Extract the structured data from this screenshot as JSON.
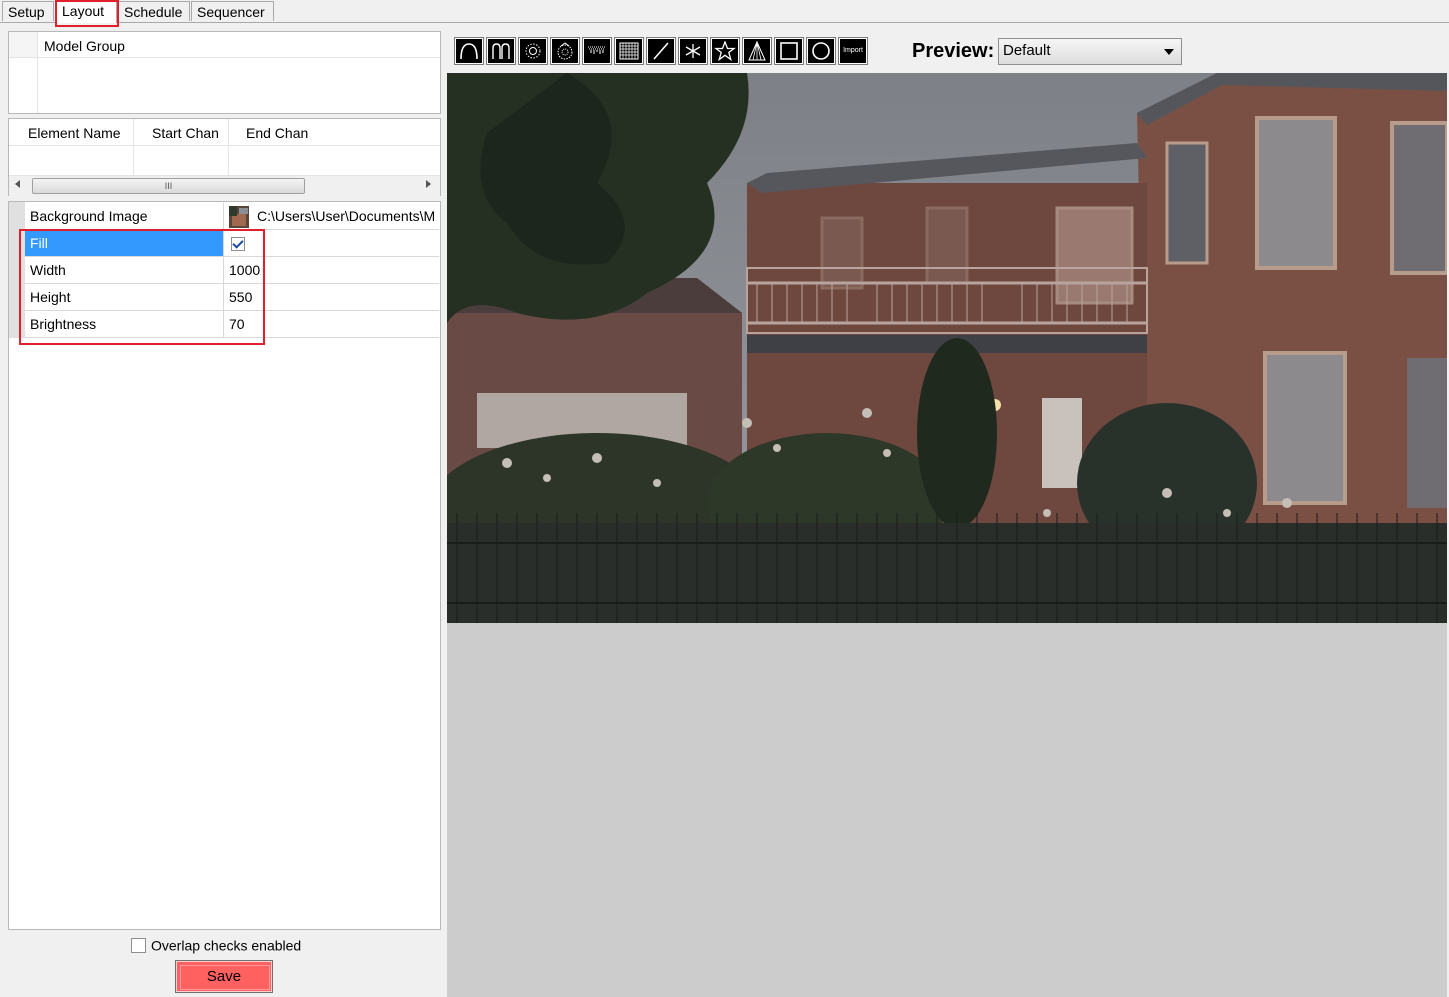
{
  "tabs": [
    {
      "label": "Setup"
    },
    {
      "label": "Layout"
    },
    {
      "label": "Schedule"
    },
    {
      "label": "Sequencer"
    }
  ],
  "model_group": {
    "header": "Model Group"
  },
  "elements_table": {
    "columns": [
      "Element Name",
      "Start Chan",
      "End Chan"
    ],
    "scroll_thumb_glyph": "III"
  },
  "properties": [
    {
      "name": "Background Image",
      "value": "C:\\Users\\User\\Documents\\M"
    },
    {
      "name": "Fill",
      "value": "",
      "checked": true
    },
    {
      "name": "Width",
      "value": "1000"
    },
    {
      "name": "Height",
      "value": "550"
    },
    {
      "name": "Brightness",
      "value": "70"
    }
  ],
  "toolbar": {
    "tools": [
      "arch-icon",
      "candy-cane-icon",
      "spinner-icon",
      "wreath-icon",
      "icicles-icon",
      "matrix-icon",
      "single-line-icon",
      "star-burst-icon",
      "star-icon",
      "tree-icon",
      "window-frame-icon",
      "circle-icon",
      "import-icon"
    ],
    "import_label": "Import"
  },
  "preview": {
    "label": "Preview:",
    "selected": "Default"
  },
  "footer": {
    "overlap_label": "Overlap checks enabled",
    "overlap_checked": false,
    "save_label": "Save"
  },
  "colors": {
    "selection": "#3399ff",
    "highlight_box": "#e0202c",
    "save_button": "#ff6161",
    "canvas_bg": "#cccccc"
  }
}
